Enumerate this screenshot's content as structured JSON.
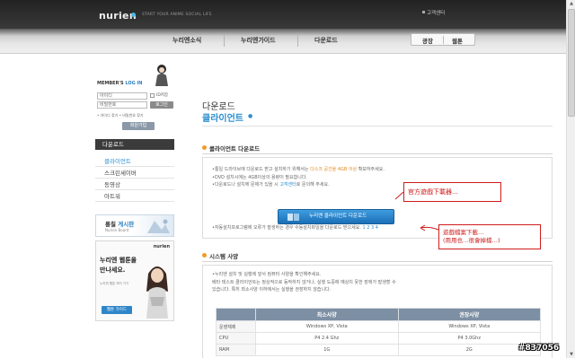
{
  "header": {
    "logo": "nurien",
    "tagline": "START YOUR ANIME SOCIAL LIFE",
    "top_link": "고객센터",
    "nav": [
      "누리엔소식",
      "누리엔가이드",
      "다운로드"
    ],
    "right_buttons": [
      "광장",
      "웹툰"
    ]
  },
  "login": {
    "title_a": "MEMBER'S ",
    "title_b": "LOG IN",
    "id_placeholder": "아이디",
    "pw_placeholder": "비밀번호",
    "save_id": "ID저장",
    "login_button": "로그인",
    "links": "• 아이디 찾기  • 비밀번호 찾기",
    "join_button": "회원가입"
  },
  "sidebar": {
    "heading": "다운로드",
    "items": [
      {
        "label": "클라이언트",
        "active": true
      },
      {
        "label": "스크린세이버",
        "active": false
      },
      {
        "label": "동영상",
        "active": false
      },
      {
        "label": "아트워",
        "active": false
      }
    ]
  },
  "board_banner": {
    "title_a": "롱칠 ",
    "title_b": "게시판",
    "subtitle": "Nurien Board"
  },
  "ad": {
    "brand": "nurien",
    "line1": "누리엔 웹툰을",
    "line2": "만나세요.",
    "small": "누리엔 웹툰 보러 가기",
    "button": "웹툰 가이드"
  },
  "main": {
    "title": "다운로드",
    "subtitle": "클라이언트",
    "download_section": {
      "heading": "클라이언트 다운로드",
      "lines_a": [
        {
          "pre": "•통일 드라이브에 다운로드 받고 설치하기 위해서는 ",
          "hl": "다스크 공간을 4GB 이상",
          "post": " 확보하주세요."
        },
        {
          "pre": "•DVD 설치시에는 4GB이상의 용량이 필요합니다.",
          "hl": "",
          "post": ""
        },
        {
          "pre": "•다운로드나 설치에 문제가 있을 시 ",
          "hl": "고객센터",
          "post": "로 문의해 주세요."
        }
      ],
      "button": "누리엔 클라이언트 다운로드",
      "split_text": "•자동설치프로그램에 오류가 발생하는 경우 수동설치파일을 다운로드 받으세요.",
      "split_links": "1 2 3 4"
    },
    "system_section": {
      "heading": "시스템 사양",
      "lines": [
        "•누리엔 설치 및 실행에 앞서 컴퓨터 사양을 확인해주세요.",
        "베타 테스트 클라이언트는 정상적으로 동작하지 않거나, 실행 도중에 예상치 못한 장애가 발생할 수",
        "있습니다. 특히 최소사양 이하에서는 실행을 권장하지 않습니다."
      ],
      "table": {
        "headers": [
          "",
          "최소사양",
          "권장사양"
        ],
        "rows": [
          [
            "운영체제",
            "Windows XP, Vista",
            "Windows XP, Vista"
          ],
          [
            "CPU",
            "P4 2.4 Ghz",
            "P4 3.0Ghz"
          ],
          [
            "RAM",
            "1G",
            "2G"
          ]
        ]
      }
    }
  },
  "annotations": {
    "note1": "官方遊戲下載器…",
    "note2_line1": "遊戲檔案下載…",
    "note2_line2": "(用用也…很會掉檔…)"
  },
  "watermark": "#837056"
}
